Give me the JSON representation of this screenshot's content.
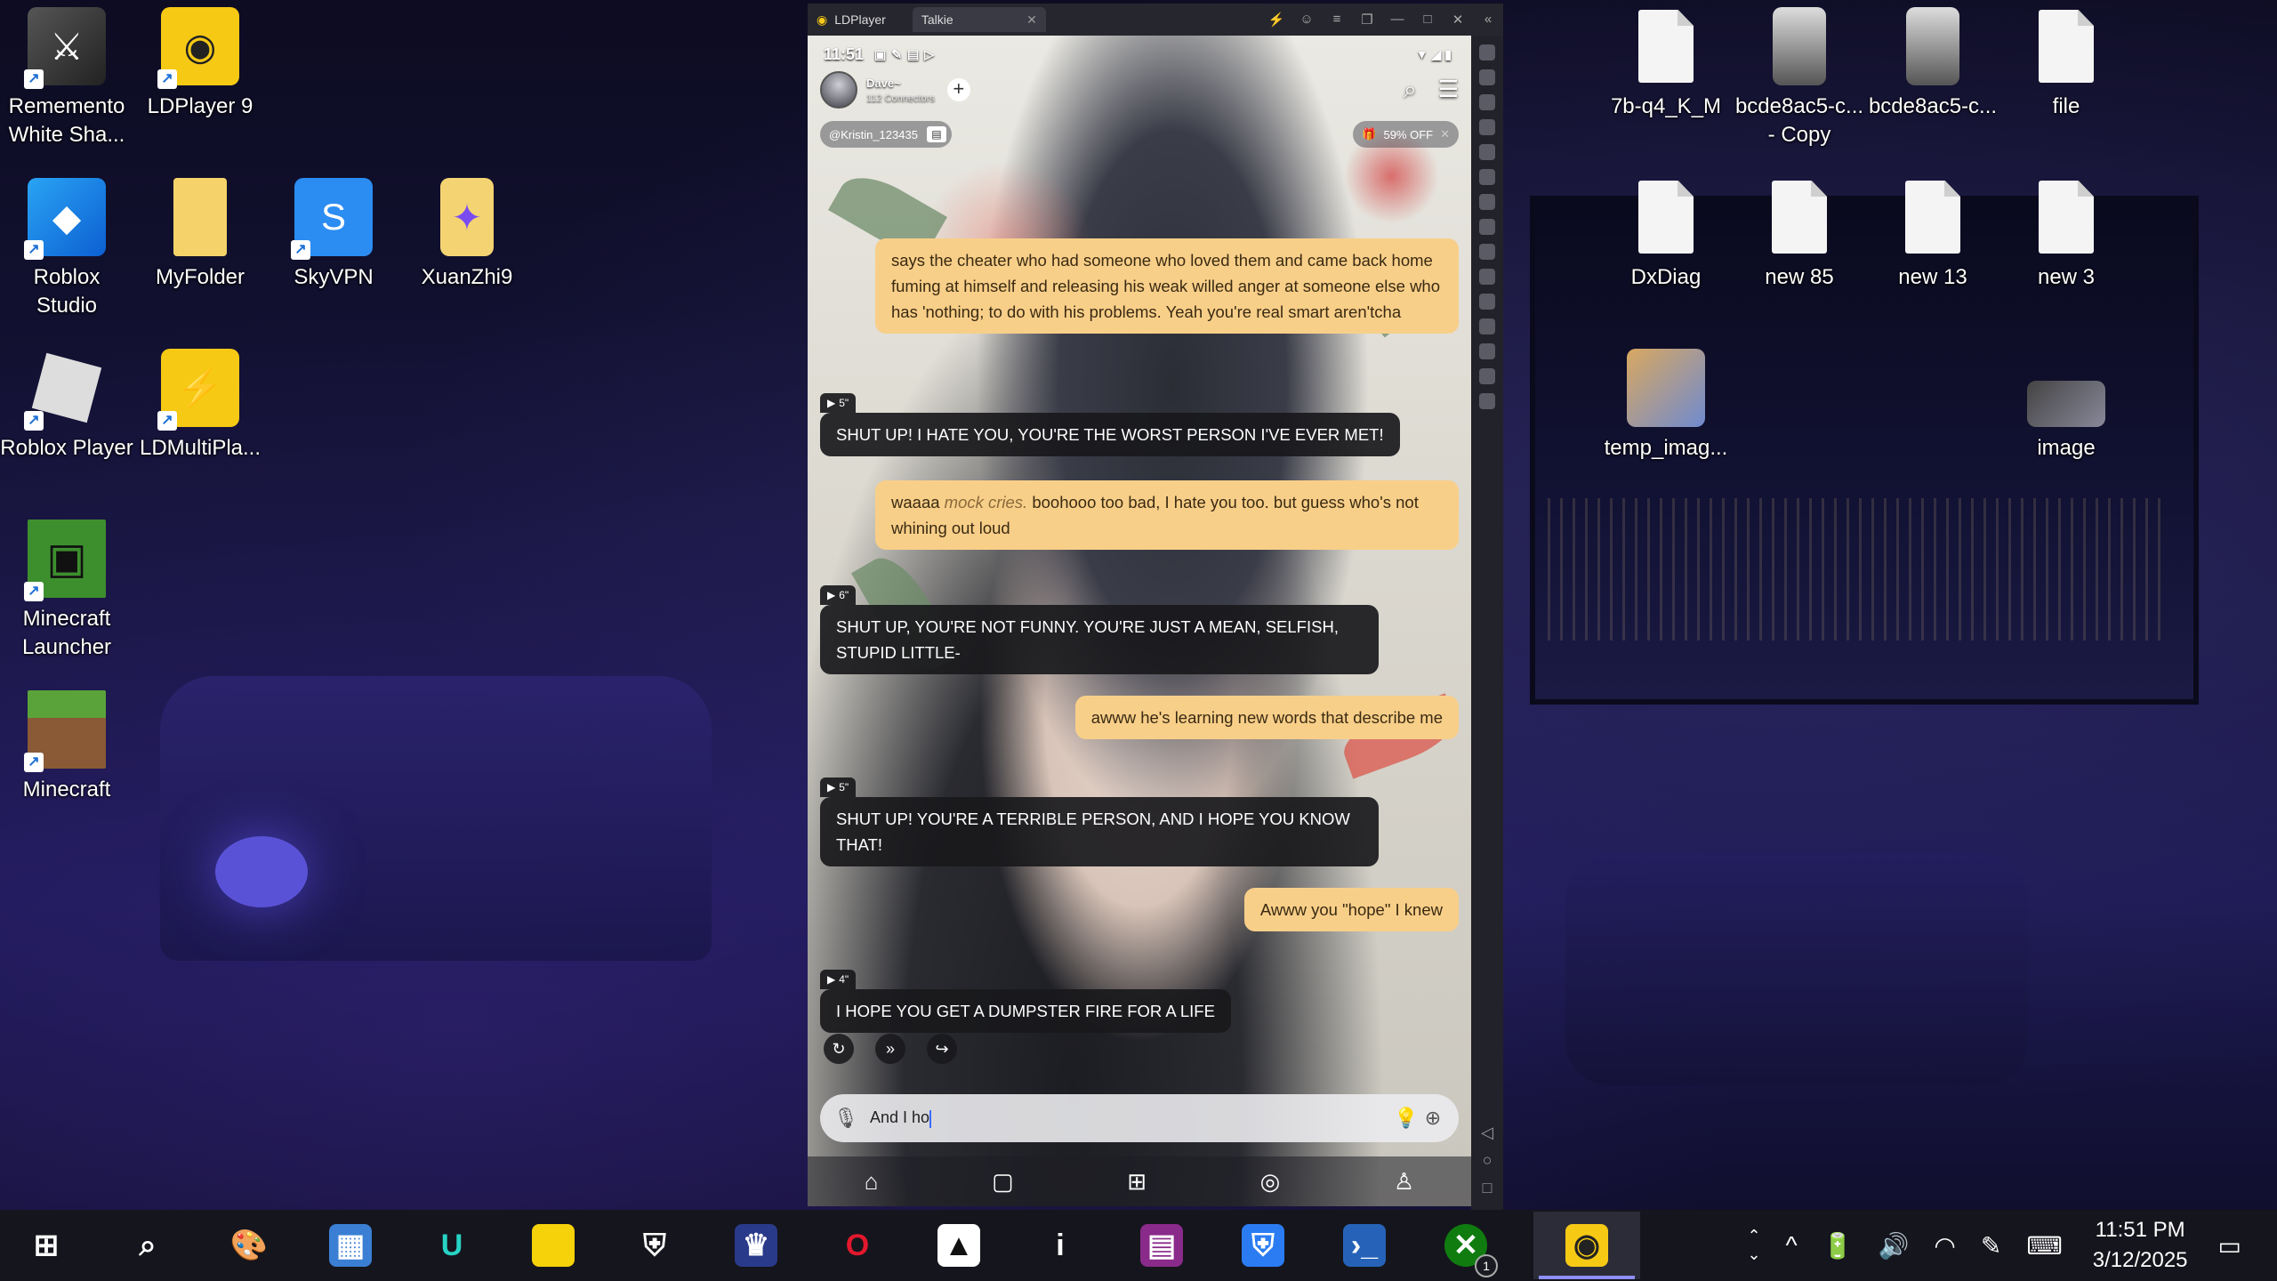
{
  "desktop_left": [
    {
      "label": "Rememento\nWhite Sha...",
      "icon": "rememento-icon"
    },
    {
      "label": "LDPlayer 9",
      "icon": "ldplayer-icon"
    },
    {
      "label": "Roblox\nStudio",
      "icon": "roblox-studio-icon"
    },
    {
      "label": "MyFolder",
      "icon": "folder-icon"
    },
    {
      "label": "SkyVPN",
      "icon": "skyvpn-icon"
    },
    {
      "label": "XuanZhi9",
      "icon": "xuanzhi-icon"
    },
    {
      "label": "Roblox Player",
      "icon": "roblox-player-icon"
    },
    {
      "label": "LDMultiPla...",
      "icon": "ldmultiplayer-icon"
    },
    {
      "label": "Minecraft\nLauncher",
      "icon": "minecraft-launcher-icon"
    },
    {
      "label": "Minecraft",
      "icon": "minecraft-icon"
    }
  ],
  "desktop_right": [
    {
      "label": "7b-q4_K_M"
    },
    {
      "label": "bcde8ac5-c...\n- Copy"
    },
    {
      "label": "bcde8ac5-c..."
    },
    {
      "label": "file"
    },
    {
      "label": "DxDiag"
    },
    {
      "label": "new 85"
    },
    {
      "label": "new 13"
    },
    {
      "label": "new 3"
    },
    {
      "label": "temp_imag..."
    },
    {
      "label": "image"
    }
  ],
  "emulator": {
    "app_tab": "LDPlayer",
    "game_tab": "Talkie",
    "status_time": "11:51",
    "character_name": "Dave~",
    "connectors": "112 Connectors",
    "user_handle": "@Kristin_123435",
    "promo": "59% OFF",
    "messages": [
      {
        "role": "user",
        "text": "says the cheater who had someone who loved them and came back home fuming at himself and releasing his weak willed anger at someone else who has 'nothing; to do with his problems. Yeah you're real smart aren'tcha"
      },
      {
        "role": "bot",
        "duration": "5\"",
        "text": "SHUT UP! I HATE YOU, YOU'RE THE WORST PERSON I'VE EVER MET!"
      },
      {
        "role": "user",
        "pre": "waaaa ",
        "action": "mock cries.",
        "post": " boohooo too bad, I hate you too. but guess who's not whining out loud"
      },
      {
        "role": "bot",
        "duration": "6\"",
        "text": "SHUT UP, YOU'RE NOT FUNNY. YOU'RE JUST A MEAN, SELFISH, STUPID LITTLE-"
      },
      {
        "role": "user",
        "text": "awww he's learning new words that describe me"
      },
      {
        "role": "bot",
        "duration": "5\"",
        "text": "SHUT UP! YOU'RE A TERRIBLE PERSON, AND I HOPE YOU KNOW THAT!"
      },
      {
        "role": "user",
        "text": "Awww you \"hope\" I knew"
      },
      {
        "role": "bot",
        "duration": "4\"",
        "text": "I HOPE YOU GET A DUMPSTER FIRE FOR A LIFE"
      }
    ],
    "input_value": "And I ho"
  },
  "taskbar": {
    "time": "11:51 PM",
    "date": "3/12/2025",
    "xbox_badge": "1"
  },
  "colors": {
    "user_bubble": "#f8cf89",
    "bot_bubble": "#19191c",
    "taskbar": "#15151d"
  }
}
